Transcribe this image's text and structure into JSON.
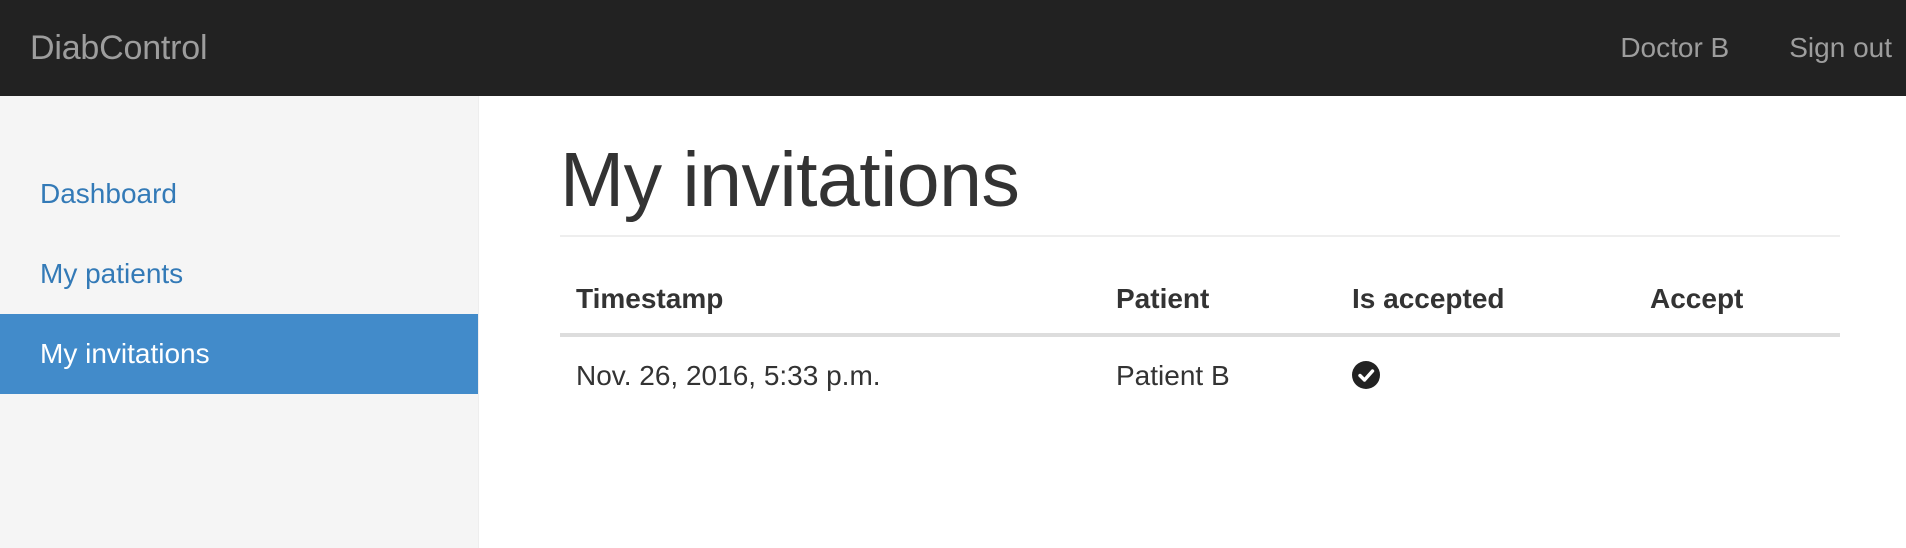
{
  "navbar": {
    "brand": "DiabControl",
    "user_link": "Doctor B",
    "signout_link": "Sign out"
  },
  "sidebar": {
    "items": [
      {
        "label": "Dashboard",
        "active": false
      },
      {
        "label": "My patients",
        "active": false
      },
      {
        "label": "My invitations",
        "active": true
      }
    ]
  },
  "main": {
    "title": "My invitations",
    "table": {
      "headers": [
        "Timestamp",
        "Patient",
        "Is accepted",
        "Accept"
      ],
      "rows": [
        {
          "timestamp": "Nov. 26, 2016, 5:33 p.m.",
          "patient": "Patient B",
          "is_accepted_icon": "check-circle-icon",
          "accept": ""
        }
      ]
    }
  },
  "colors": {
    "navbar_bg": "#222222",
    "nav_text": "#9d9d9d",
    "link": "#337ab7",
    "active_bg": "#428bca"
  }
}
